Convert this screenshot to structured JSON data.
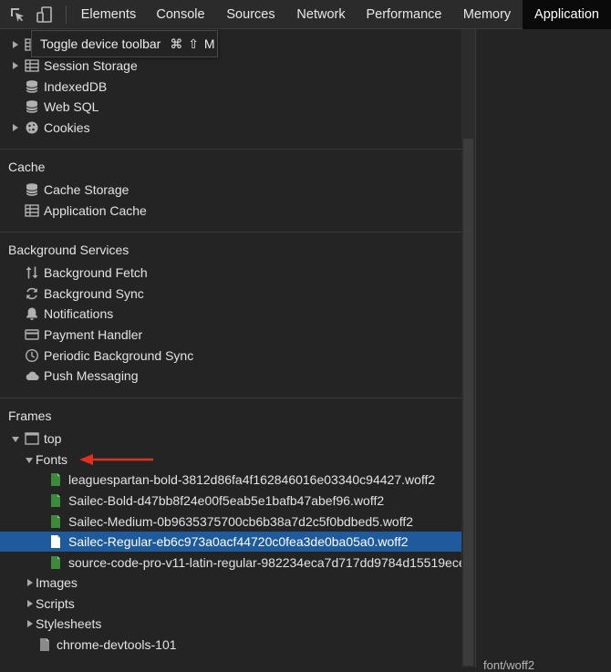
{
  "tabs": [
    {
      "label": "Elements"
    },
    {
      "label": "Console"
    },
    {
      "label": "Sources"
    },
    {
      "label": "Network"
    },
    {
      "label": "Performance"
    },
    {
      "label": "Memory"
    },
    {
      "label": "Application",
      "active": true
    }
  ],
  "tooltip": {
    "text": "Toggle device toolbar",
    "shortcut": "⌘ ⇧ M"
  },
  "storage": {
    "items": [
      {
        "label": "Session Storage"
      },
      {
        "label": "IndexedDB"
      },
      {
        "label": "Web SQL"
      },
      {
        "label": "Cookies"
      }
    ]
  },
  "cache": {
    "title": "Cache",
    "items": [
      {
        "label": "Cache Storage"
      },
      {
        "label": "Application Cache"
      }
    ]
  },
  "background_services": {
    "title": "Background Services",
    "items": [
      {
        "label": "Background Fetch"
      },
      {
        "label": "Background Sync"
      },
      {
        "label": "Notifications"
      },
      {
        "label": "Payment Handler"
      },
      {
        "label": "Periodic Background Sync"
      },
      {
        "label": "Push Messaging"
      }
    ]
  },
  "frames": {
    "title": "Frames",
    "top_label": "top",
    "fonts_label": "Fonts",
    "font_files": [
      {
        "label": "leaguespartan-bold-3812d86fa4f162846016e03340c94427.woff2"
      },
      {
        "label": "Sailec-Bold-d47bb8f24e00f5eab5e1bafb47abef96.woff2"
      },
      {
        "label": "Sailec-Medium-0b9635375700cb6b38a7d2c5f0bdbed5.woff2"
      },
      {
        "label": "Sailec-Regular-eb6c973a0acf44720c0fea3de0ba05a0.woff2",
        "selected": true
      },
      {
        "label": "source-code-pro-v11-latin-regular-982234eca7d717dd9784d15519ece"
      }
    ],
    "images_label": "Images",
    "scripts_label": "Scripts",
    "stylesheets_label": "Stylesheets",
    "child_frame_label": "chrome-devtools-101"
  },
  "right_pane": {
    "bottom_text": "font/woff2"
  },
  "colors": {
    "accent_selected": "#1f5a9d",
    "active_tab": "#0a0a0a",
    "annotation_arrow": "#e0301e",
    "font_icon": "#3c8a3c"
  }
}
